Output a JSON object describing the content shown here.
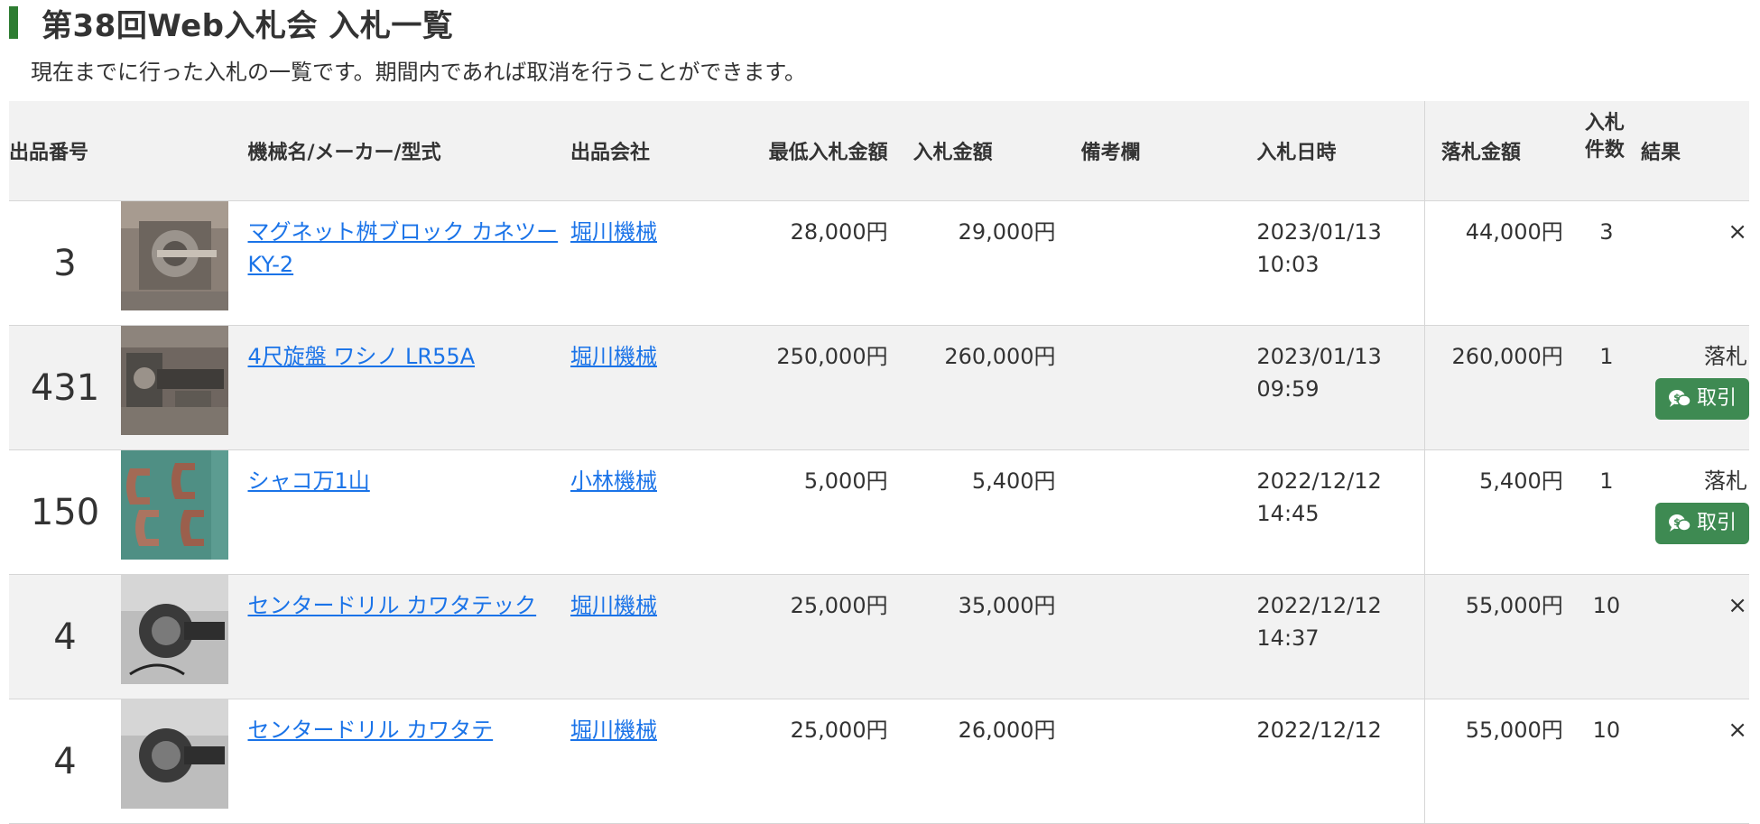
{
  "page": {
    "title": "第38回Web入札会 入札一覧",
    "description": "現在までに行った入札の一覧です。期間内であれば取消を行うことができます。"
  },
  "table": {
    "headers": {
      "lot_no": "出品番号",
      "machine": "機械名/メーカー/型式",
      "company": "出品会社",
      "min_bid": "最低入札金額",
      "bid": "入札金額",
      "remarks": "備考欄",
      "bid_date": "入札日時",
      "win_price": "落札金額",
      "count_line1": "入札",
      "count_line2": "件数",
      "result": "結果"
    },
    "rows": [
      {
        "lot_no": "3",
        "thumbnail": "magnet-block-photo",
        "machine": "マグネット桝ブロック カネツー KY-2",
        "company": "堀川機械",
        "min_bid": "28,000円",
        "bid": "29,000円",
        "remarks": "",
        "bid_date": "2023/01/13",
        "bid_time": "10:03",
        "win_price": "44,000円",
        "count": "3",
        "result": "×",
        "deal_button": ""
      },
      {
        "lot_no": "431",
        "thumbnail": "lathe-photo",
        "machine": "4尺旋盤 ワシノ LR55A",
        "company": "堀川機械",
        "min_bid": "250,000円",
        "bid": "260,000円",
        "remarks": "",
        "bid_date": "2023/01/13",
        "bid_time": "09:59",
        "win_price": "260,000円",
        "count": "1",
        "result": "落札",
        "deal_button": "取引"
      },
      {
        "lot_no": "150",
        "thumbnail": "c-clamps-photo",
        "machine": "シャコ万1山",
        "company": "小林機械",
        "min_bid": "5,000円",
        "bid": "5,400円",
        "remarks": "",
        "bid_date": "2022/12/12",
        "bid_time": "14:45",
        "win_price": "5,400円",
        "count": "1",
        "result": "落札",
        "deal_button": "取引"
      },
      {
        "lot_no": "4",
        "thumbnail": "center-drill-photo",
        "machine": "センタードリル カワタテック",
        "company": "堀川機械",
        "min_bid": "25,000円",
        "bid": "35,000円",
        "remarks": "",
        "bid_date": "2022/12/12",
        "bid_time": "14:37",
        "win_price": "55,000円",
        "count": "10",
        "result": "×",
        "deal_button": ""
      },
      {
        "lot_no": "4",
        "thumbnail": "center-drill-photo",
        "machine": "センタードリル カワタテ",
        "company": "堀川機械",
        "min_bid": "25,000円",
        "bid": "26,000円",
        "remarks": "",
        "bid_date": "2022/12/12",
        "bid_time": "",
        "win_price": "55,000円",
        "count": "10",
        "result": "×",
        "deal_button": ""
      }
    ]
  },
  "colors": {
    "accent_green": "#2e7d32",
    "button_green": "#3e8a52",
    "link_blue": "#1a73e8",
    "row_alt": "#f2f2f2"
  }
}
